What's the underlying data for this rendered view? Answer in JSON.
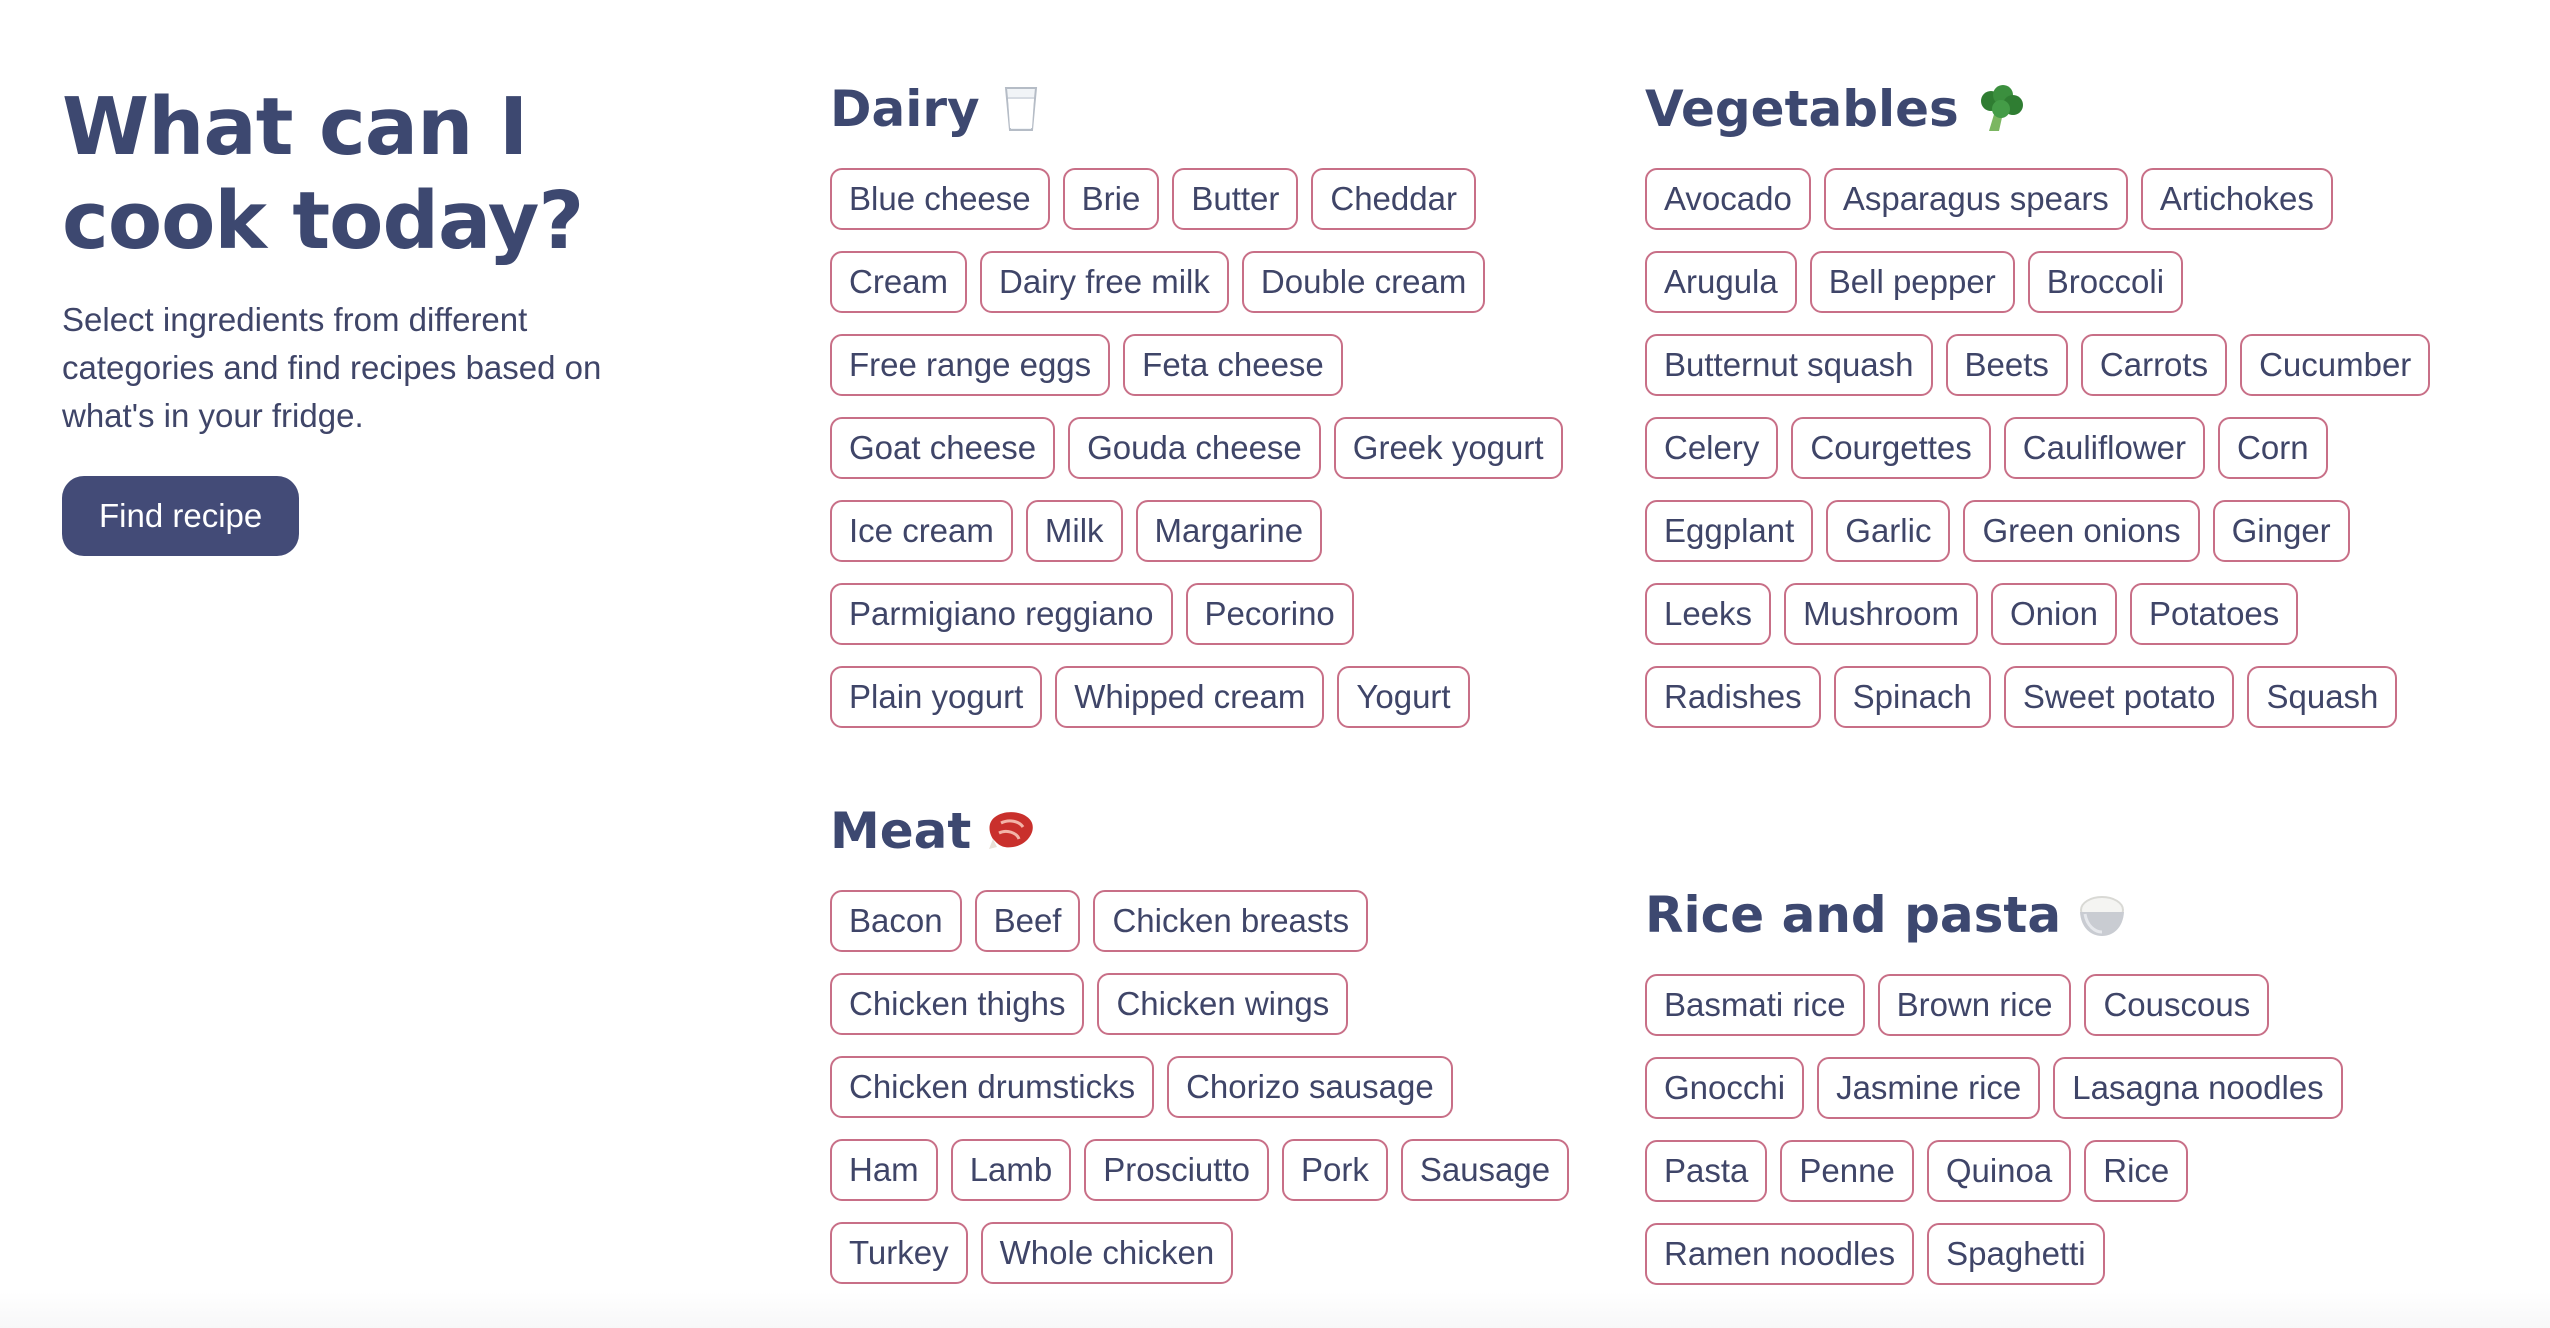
{
  "intro": {
    "title_line1": "What can I",
    "title_line2": "cook today?",
    "description": "Select ingredients from different categories and find recipes based on what's in your fridge.",
    "button_label": "Find recipe"
  },
  "colors": {
    "heading": "#3d4870",
    "button_bg": "#434b77",
    "chip_border": "#c86f87",
    "text": "#3f4568"
  },
  "categories": {
    "dairy": {
      "title": "Dairy",
      "icon": "milk-glass-icon",
      "items": [
        "Blue cheese",
        "Brie",
        "Butter",
        "Cheddar",
        "Cream",
        "Dairy free milk",
        "Double cream",
        "Free range eggs",
        "Feta cheese",
        "Goat cheese",
        "Gouda cheese",
        "Greek yogurt",
        "Ice cream",
        "Milk",
        "Margarine",
        "Parmigiano reggiano",
        "Pecorino",
        "Plain yogurt",
        "Whipped cream",
        "Yogurt"
      ]
    },
    "meat": {
      "title": "Meat",
      "icon": "meat-cut-icon",
      "items": [
        "Bacon",
        "Beef",
        "Chicken breasts",
        "Chicken thighs",
        "Chicken wings",
        "Chicken drumsticks",
        "Chorizo sausage",
        "Ham",
        "Lamb",
        "Prosciutto",
        "Pork",
        "Sausage",
        "Turkey",
        "Whole chicken"
      ]
    },
    "vegetables": {
      "title": "Vegetables",
      "icon": "broccoli-icon",
      "items": [
        "Avocado",
        "Asparagus spears",
        "Artichokes",
        "Arugula",
        "Bell pepper",
        "Broccoli",
        "Butternut squash",
        "Beets",
        "Carrots",
        "Cucumber",
        "Celery",
        "Courgettes",
        "Cauliflower",
        "Corn",
        "Eggplant",
        "Garlic",
        "Green onions",
        "Ginger",
        "Leeks",
        "Mushroom",
        "Onion",
        "Potatoes",
        "Radishes",
        "Spinach",
        "Sweet potato",
        "Squash"
      ]
    },
    "rice": {
      "title": "Rice and pasta",
      "icon": "rice-bowl-icon",
      "items": [
        "Basmati rice",
        "Brown rice",
        "Couscous",
        "Gnocchi",
        "Jasmine rice",
        "Lasagna noodles",
        "Pasta",
        "Penne",
        "Quinoa",
        "Rice",
        "Ramen noodles",
        "Spaghetti"
      ]
    }
  }
}
